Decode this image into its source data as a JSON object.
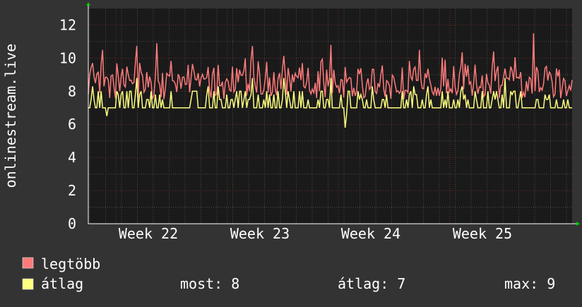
{
  "chart_data": {
    "type": "line",
    "ylabel": "onlinestream.live",
    "xlabel": "",
    "ylim": [
      0,
      13
    ],
    "y_ticks": [
      "0",
      "2",
      "4",
      "6",
      "8",
      "10",
      "12"
    ],
    "x_ticks": [
      "Week 22",
      "Week 23",
      "Week 24",
      "Week 25"
    ],
    "grid": true,
    "background": "#1a1a1a",
    "series": [
      {
        "name": "legtöbb",
        "color": "#ff7b7b"
      },
      {
        "name": "átlag",
        "color": "#ffff80"
      }
    ],
    "stats": {
      "most": "most: 8",
      "atlag": "átlag: 7",
      "max": "max: 9"
    }
  }
}
